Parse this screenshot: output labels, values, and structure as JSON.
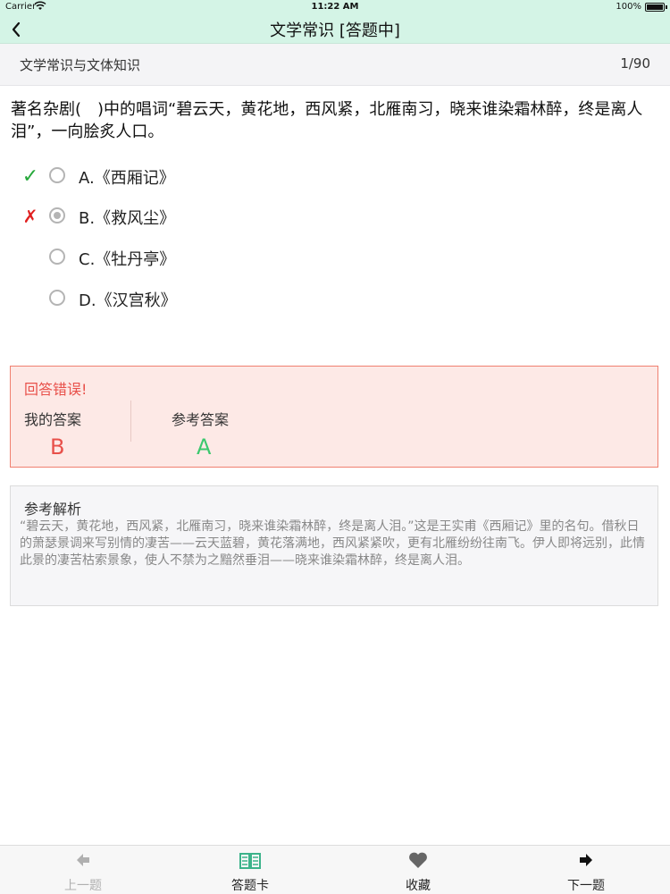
{
  "status_bar": {
    "carrier": "Carrier",
    "time": "11:22 AM",
    "battery": "100%"
  },
  "nav": {
    "title": "文学常识 [答题中]",
    "back_icon": "chevron-left-icon"
  },
  "category": {
    "name": "文学常识与文体知识",
    "progress": "1/90"
  },
  "question": {
    "text": "著名杂剧(　)中的唱词“碧云天，黄花地，西风紧，北雁南习，晓来谁染霜林醉，终是离人泪”，一向脍炙人口。"
  },
  "options": [
    {
      "label": "A.《西厢记》",
      "mark": "✓",
      "state": "correct"
    },
    {
      "label": "B.《救风尘》",
      "mark": "✗",
      "state": "wrong-selected"
    },
    {
      "label": "C.《牡丹亭》",
      "mark": "",
      "state": "none"
    },
    {
      "label": "D.《汉宫秋》",
      "mark": "",
      "state": "none"
    }
  ],
  "result": {
    "status": "回答错误!",
    "mine_label": "我的答案",
    "mine_value": "B",
    "ref_label": "参考答案",
    "ref_value": "A",
    "colors": {
      "wrong": "#e8504a",
      "correct": "#3cc86e",
      "border": "#f08070",
      "background": "#fde9e6"
    }
  },
  "explanation": {
    "title": "参考解析",
    "body": "“碧云天，黄花地，西风紧，北雁南习，晓来谁染霜林醉，终是离人泪。”这是王实甫《西厢记》里的名句。借秋日的萧瑟景调来写别情的凄苦——云天蓝碧，黄花落满地，西风紧紧吹，更有北雁纷纷往南飞。伊人即将远别，此情此景的凄苦枯索景象，使人不禁为之黯然垂泪——晓来谁染霜林醉，终是离人泪。"
  },
  "tabs": [
    {
      "label": "上一题",
      "icon": "arrow-left-icon",
      "enabled": false
    },
    {
      "label": "答题卡",
      "icon": "open-book-icon",
      "enabled": true
    },
    {
      "label": "收藏",
      "icon": "heart-icon",
      "enabled": true
    },
    {
      "label": "下一题",
      "icon": "arrow-right-icon",
      "enabled": true
    }
  ],
  "theme": {
    "header_bg": "#d4f4e6",
    "accent_green": "#3cb38a"
  }
}
